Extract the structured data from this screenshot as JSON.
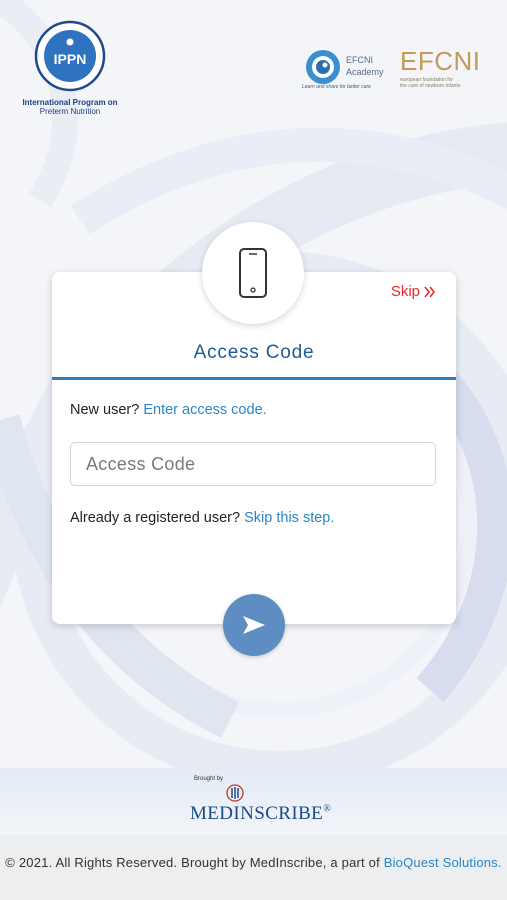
{
  "header": {
    "ippn_badge": "IPPN",
    "ippn_caption_line1": "International Program on",
    "ippn_caption_line2": "Preterm Nutrition",
    "efcni_academy_line1": "EFCNI",
    "efcni_academy_line2": "Academy",
    "efcni_academy_tagline": "Learn and share for better care",
    "efcni_word": "EFCNI",
    "efcni_sub_line1": "european foundation for",
    "efcni_sub_line2": "the care of newborn infants"
  },
  "card": {
    "skip_label": "Skip",
    "title": "Access Code",
    "new_user_prefix": "New user?",
    "new_user_link": "Enter access code.",
    "input_placeholder": "Access Code",
    "input_value": "",
    "registered_prefix": "Already a registered user?",
    "registered_link": "Skip this step."
  },
  "branding": {
    "brought_by": "Brought by",
    "name": "MEDINSCRIBE",
    "registered_mark": "®"
  },
  "footer": {
    "copyright_text": "© 2021. All Rights Reserved. Brought by MedInscribe, a part of",
    "company_link": "BioQuest Solutions."
  },
  "colors": {
    "accent_blue": "#2c7dbf",
    "link_blue": "#2a86c7",
    "skip_red": "#e32c2c",
    "button_blue": "#5e8dc3"
  },
  "icons": {
    "phone": "smartphone-icon",
    "skip_chevron": "double-chevron-right-icon",
    "submit_arrow": "play-arrow-icon"
  }
}
